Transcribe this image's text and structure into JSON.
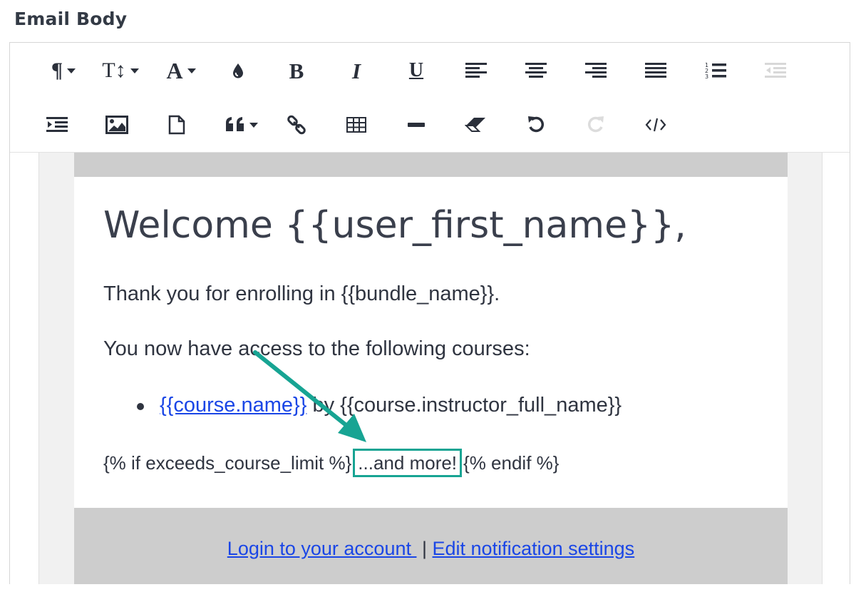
{
  "section": {
    "label": "Email Body"
  },
  "toolbar": {
    "row1": [
      {
        "name": "paragraph-style-button",
        "icon": "pilcrow-icon",
        "glyph": "¶",
        "dropdown": true
      },
      {
        "name": "font-size-button",
        "icon": "text-height-icon",
        "glyph": "T↕",
        "dropdown": true
      },
      {
        "name": "font-color-button",
        "icon": "letter-a-icon",
        "glyph": "A",
        "dropdown": true
      },
      {
        "name": "highlight-color-button",
        "icon": "droplet-icon",
        "glyph": ""
      },
      {
        "name": "bold-button",
        "icon": "bold-icon",
        "glyph": "B"
      },
      {
        "name": "italic-button",
        "icon": "italic-icon",
        "glyph": "I"
      },
      {
        "name": "underline-button",
        "icon": "underline-icon",
        "glyph": "U"
      },
      {
        "name": "align-left-button",
        "icon": "align-left-icon",
        "glyph": ""
      },
      {
        "name": "align-center-button",
        "icon": "align-center-icon",
        "glyph": ""
      },
      {
        "name": "align-right-button",
        "icon": "align-right-icon",
        "glyph": ""
      },
      {
        "name": "justify-button",
        "icon": "align-justify-icon",
        "glyph": ""
      },
      {
        "name": "ordered-list-button",
        "icon": "ordered-list-icon",
        "glyph": ""
      },
      {
        "name": "outdent-button",
        "icon": "outdent-icon",
        "glyph": "",
        "disabled": true
      }
    ],
    "row2": [
      {
        "name": "indent-button",
        "icon": "indent-icon"
      },
      {
        "name": "insert-image-button",
        "icon": "image-icon"
      },
      {
        "name": "insert-file-button",
        "icon": "file-icon"
      },
      {
        "name": "blockquote-button",
        "icon": "quote-icon",
        "dropdown": true
      },
      {
        "name": "insert-link-button",
        "icon": "link-icon"
      },
      {
        "name": "insert-table-button",
        "icon": "table-icon"
      },
      {
        "name": "horizontal-rule-button",
        "icon": "minus-icon"
      },
      {
        "name": "clear-formatting-button",
        "icon": "eraser-icon"
      },
      {
        "name": "undo-button",
        "icon": "undo-icon"
      },
      {
        "name": "redo-button",
        "icon": "redo-icon",
        "disabled": true
      },
      {
        "name": "code-view-button",
        "icon": "code-icon"
      }
    ]
  },
  "email": {
    "heading": "Welcome {{user_first_name}},",
    "line1": "Thank you for enrolling in {{bundle_name}}.",
    "line2": "You now have access to the following courses:",
    "course_link": "{{course.name}}",
    "course_by": " by {{course.instructor_full_name}}",
    "condition_start": "{% if exceeds_course_limit %}",
    "more_text": "...and more!",
    "condition_end": "{% endif %}",
    "footer_link1": "Login to your account ",
    "footer_separator": " | ",
    "footer_link2": "Edit notification settings"
  },
  "colors": {
    "annotation": "#17a493",
    "link": "#1a46e6",
    "bar": "#cdcdcd"
  }
}
